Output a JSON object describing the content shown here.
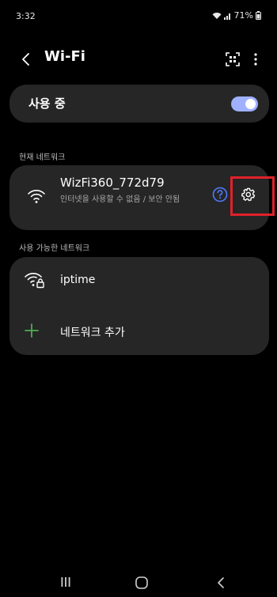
{
  "status_bar": {
    "time": "3:32",
    "battery_percent": "71%",
    "icons": [
      "wifi-signal-icon",
      "cell-signal-icon",
      "battery-icon"
    ]
  },
  "app_bar": {
    "title": "Wi-Fi",
    "icons": [
      "back-arrow-icon",
      "qr-scan-icon",
      "more-vertical-icon"
    ]
  },
  "master_toggle": {
    "label": "사용 중",
    "state": "on",
    "accent_color": "#9fb0ff"
  },
  "current_network": {
    "section_title": "현재 네트워크",
    "name": "WizFi360_772d79",
    "status": "인터넷을 사용할 수 없음 / 보안 안됨",
    "icons": [
      "wifi-icon",
      "help-circle-icon",
      "gear-icon"
    ],
    "help_color": "#4f7cff",
    "highlight_color": "#e2202a"
  },
  "available_networks": {
    "section_title": "사용 가능한 네트워크",
    "items": [
      {
        "name": "iptime",
        "icon": "wifi-lock-icon"
      }
    ],
    "add_label": "네트워크 추가",
    "add_icon": "plus-icon",
    "add_icon_color": "#4caf50"
  },
  "nav_bar": {
    "icons": [
      "recents-icon",
      "home-icon",
      "nav-back-icon"
    ]
  }
}
